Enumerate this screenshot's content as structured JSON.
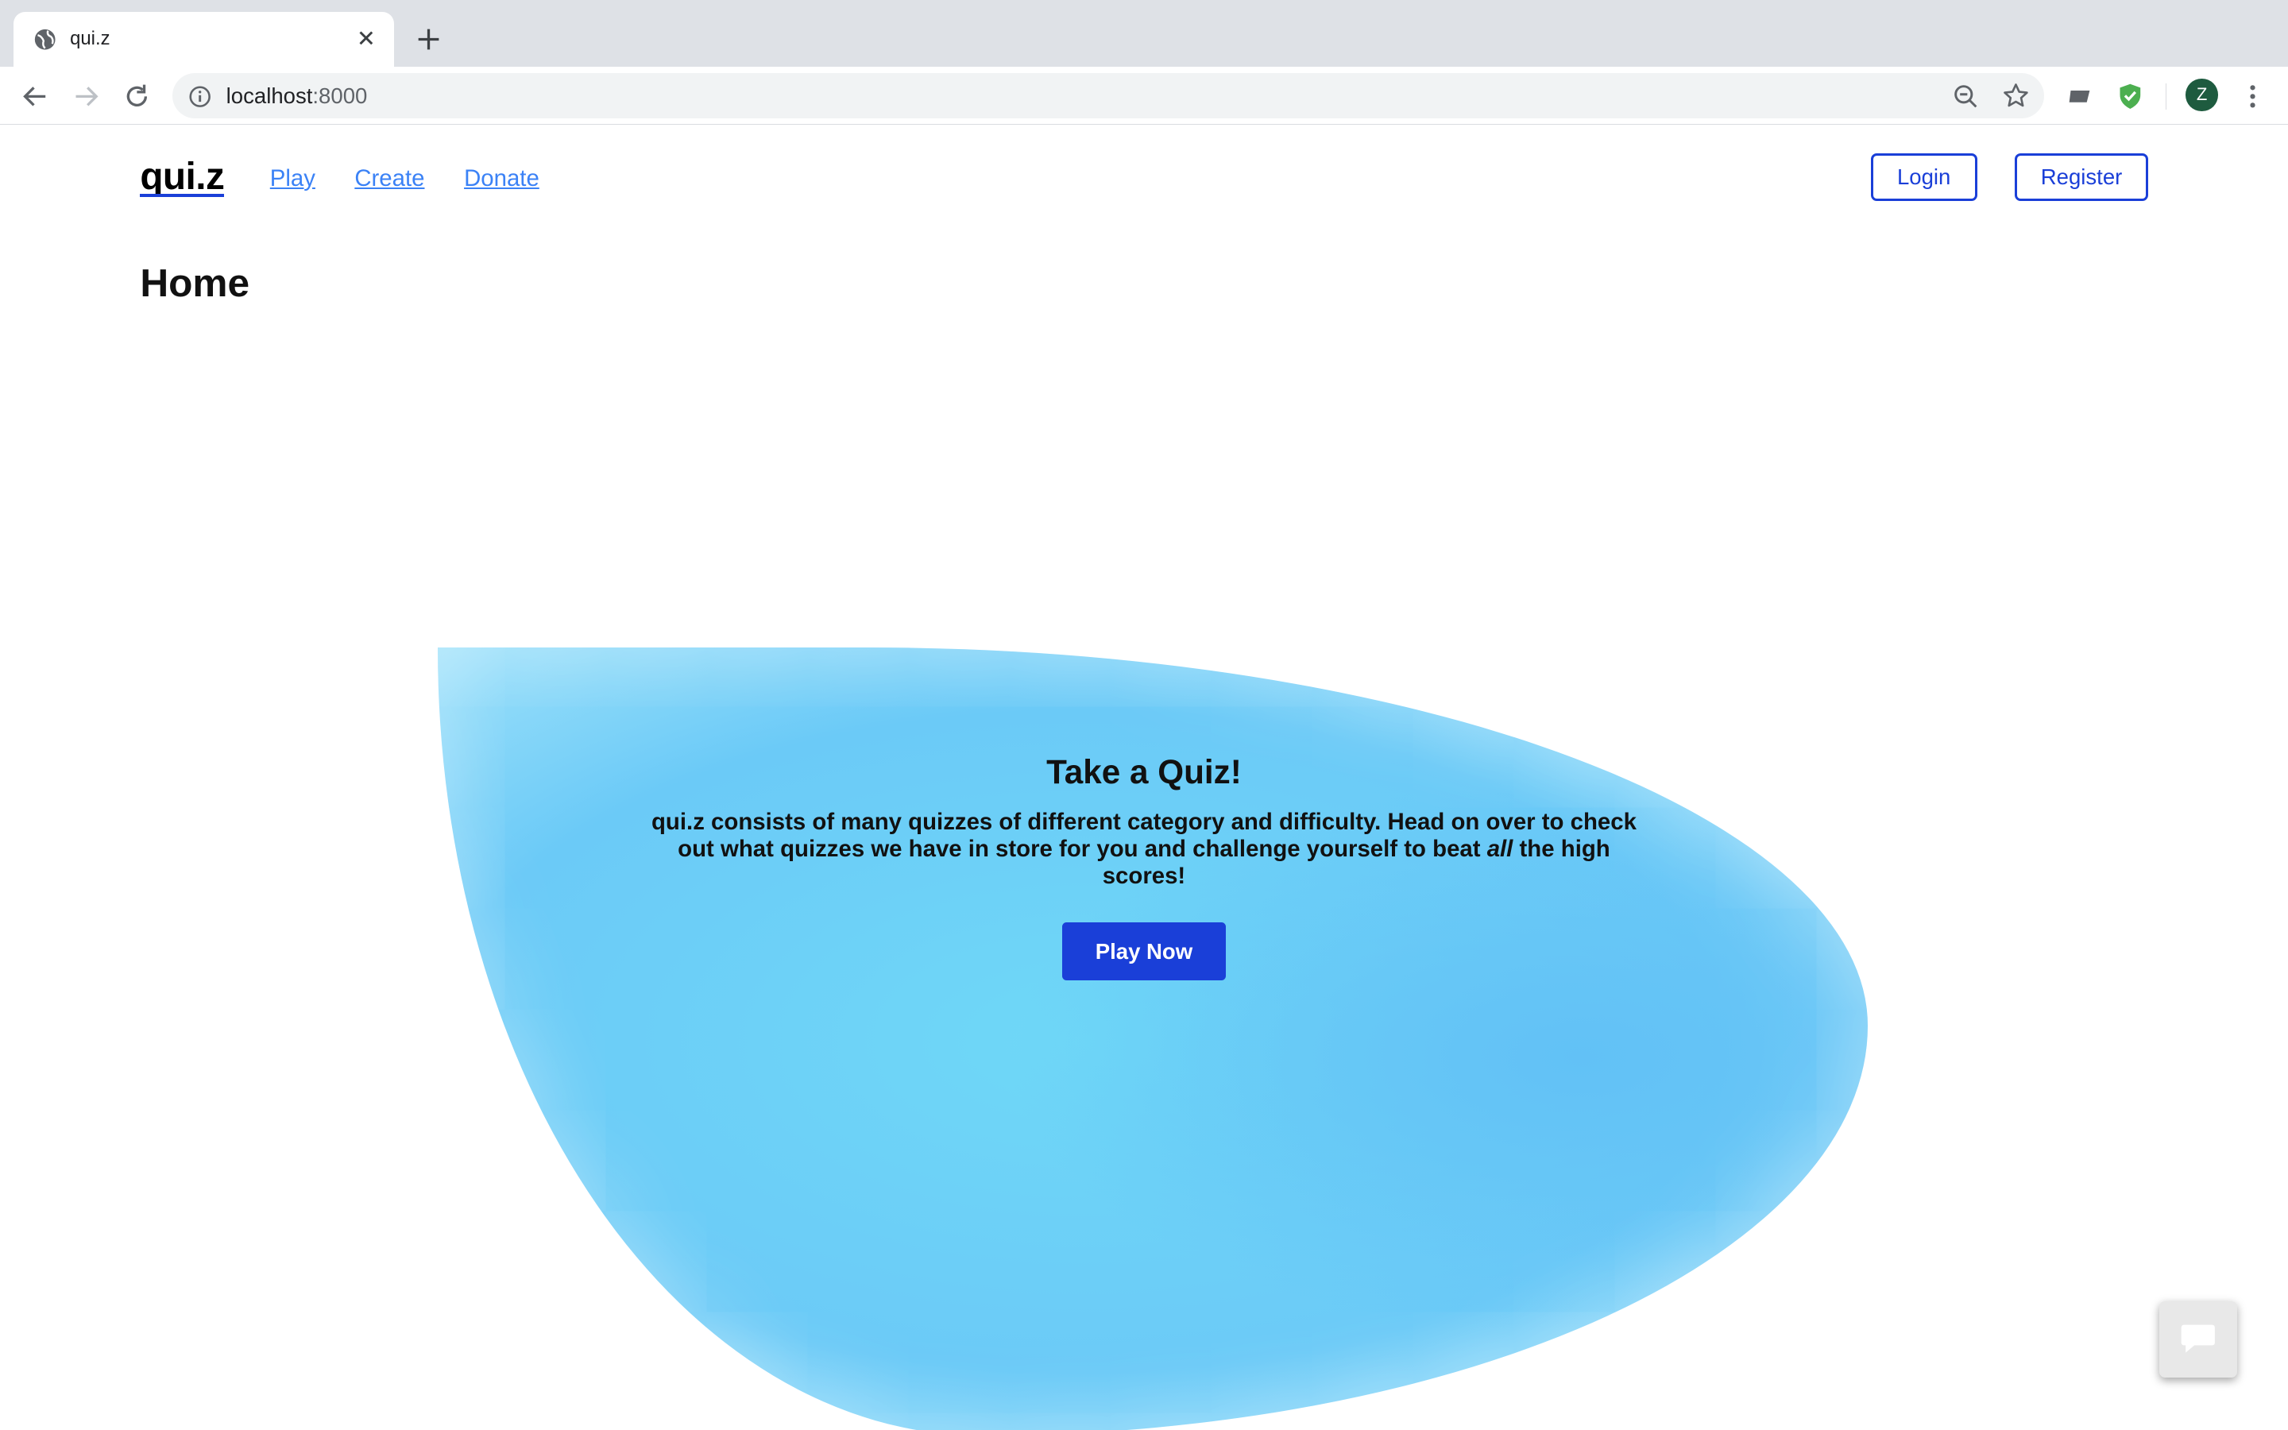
{
  "browser": {
    "tab_title": "qui.z",
    "url_host": "localhost",
    "url_port": ":8000",
    "profile_initial": "Z"
  },
  "nav": {
    "brand": "qui.z",
    "links": [
      "Play",
      "Create",
      "Donate"
    ],
    "login_label": "Login",
    "register_label": "Register"
  },
  "page": {
    "title": "Home"
  },
  "hero": {
    "heading": "Take a Quiz!",
    "text_before": "qui.z consists of many quizzes of different category and difficulty. Head on over to check out what quizzes we have in store for you and challenge yourself to beat ",
    "text_emphasis": "all",
    "text_after": " the high scores!",
    "cta_label": "Play Now"
  },
  "colors": {
    "accent": "#1a3fd8",
    "link": "#3b82f6",
    "blob": "#6fd8f7"
  },
  "icons": [
    "globe-icon",
    "close-icon",
    "plus-icon",
    "back-icon",
    "forward-icon",
    "reload-icon",
    "info-icon",
    "zoom-icon",
    "star-icon",
    "extension-icon",
    "shield-icon",
    "more-icon",
    "chat-icon"
  ]
}
